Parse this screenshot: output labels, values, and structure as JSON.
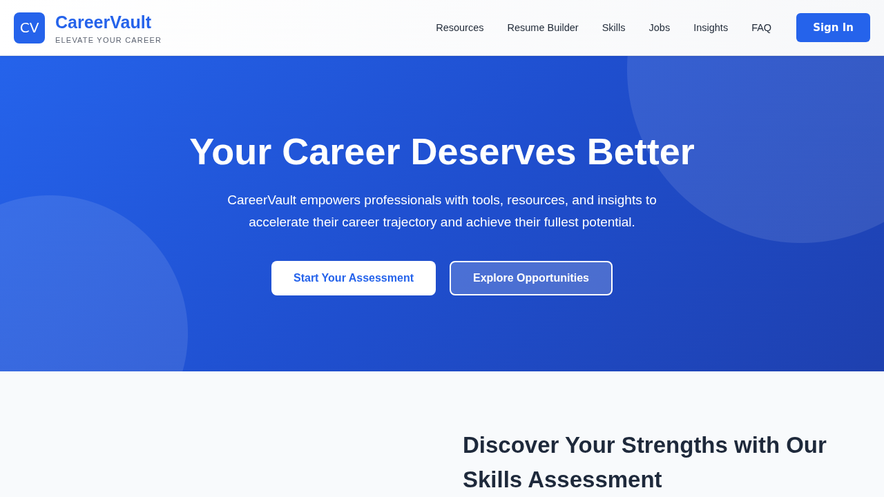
{
  "header": {
    "logo_mark": "CV",
    "brand": "CareerVault",
    "tagline": "ELEVATE YOUR CAREER",
    "nav": [
      "Resources",
      "Resume Builder",
      "Skills",
      "Jobs",
      "Insights",
      "FAQ"
    ],
    "sign_in": "Sign In"
  },
  "hero": {
    "title": "Your Career Deserves Better",
    "subtitle": "CareerVault empowers professionals with tools, resources, and insights to accelerate their career trajectory and achieve their fullest potential.",
    "buttons": [
      {
        "label": "Start Your Assessment",
        "kind": "primary"
      },
      {
        "label": "Explore Opportunities",
        "kind": "outline"
      }
    ]
  },
  "assessment": {
    "heading": "Discover Your Strengths with Our Skills Assessment"
  }
}
